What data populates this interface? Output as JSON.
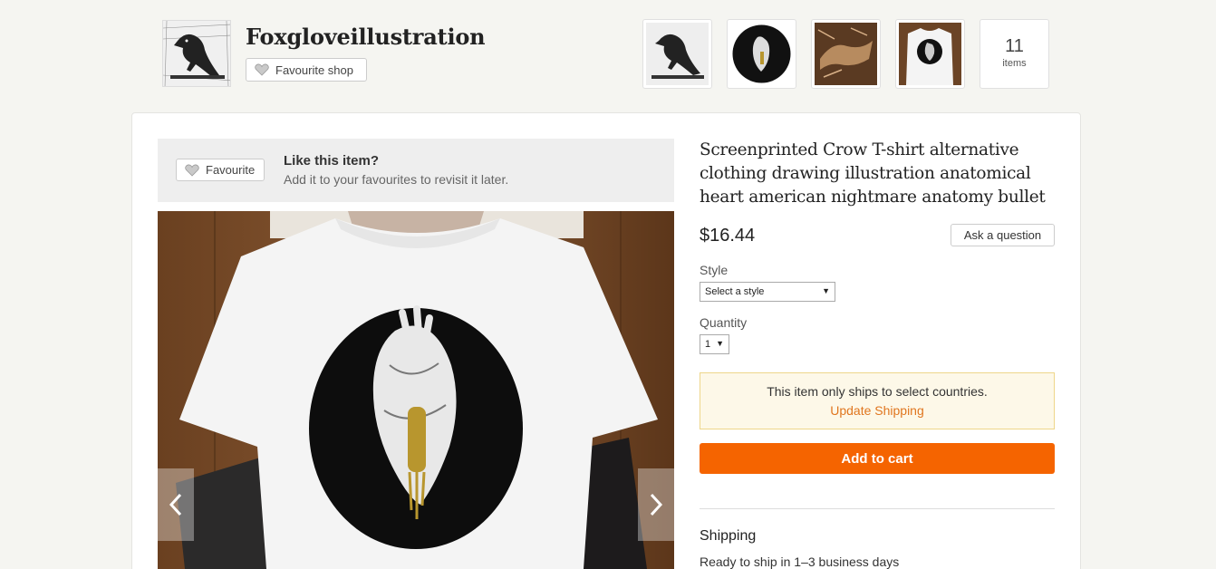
{
  "shop": {
    "name": "Foxgloveillustration",
    "favourite_label": "Favourite shop",
    "item_count": "11",
    "item_count_label": "items"
  },
  "favourite_banner": {
    "button_label": "Favourite",
    "title": "Like this item?",
    "subtitle": "Add it to your favourites to revisit it later."
  },
  "listing": {
    "title": "Screenprinted Crow T-shirt alternative clothing drawing illustration anatomical heart american nightmare anatomy bullet",
    "price": "$16.44",
    "ask_label": "Ask a question",
    "style_label": "Style",
    "style_value": "Select a style",
    "quantity_label": "Quantity",
    "quantity_value": "1",
    "ship_notice": "This item only ships to select countries.",
    "update_shipping": "Update Shipping",
    "add_to_cart": "Add to cart",
    "shipping_title": "Shipping",
    "shipping_sub": "Ready to ship in 1–3 business days"
  },
  "icons": {
    "heart": "heart-icon",
    "prev": "chevron-left-icon",
    "next": "chevron-right-icon",
    "caret": "caret-down-icon"
  },
  "colors": {
    "accent": "#f56400",
    "link": "#e0761f",
    "notice_bg": "#fdf8e8",
    "notice_border": "#eed68a"
  }
}
